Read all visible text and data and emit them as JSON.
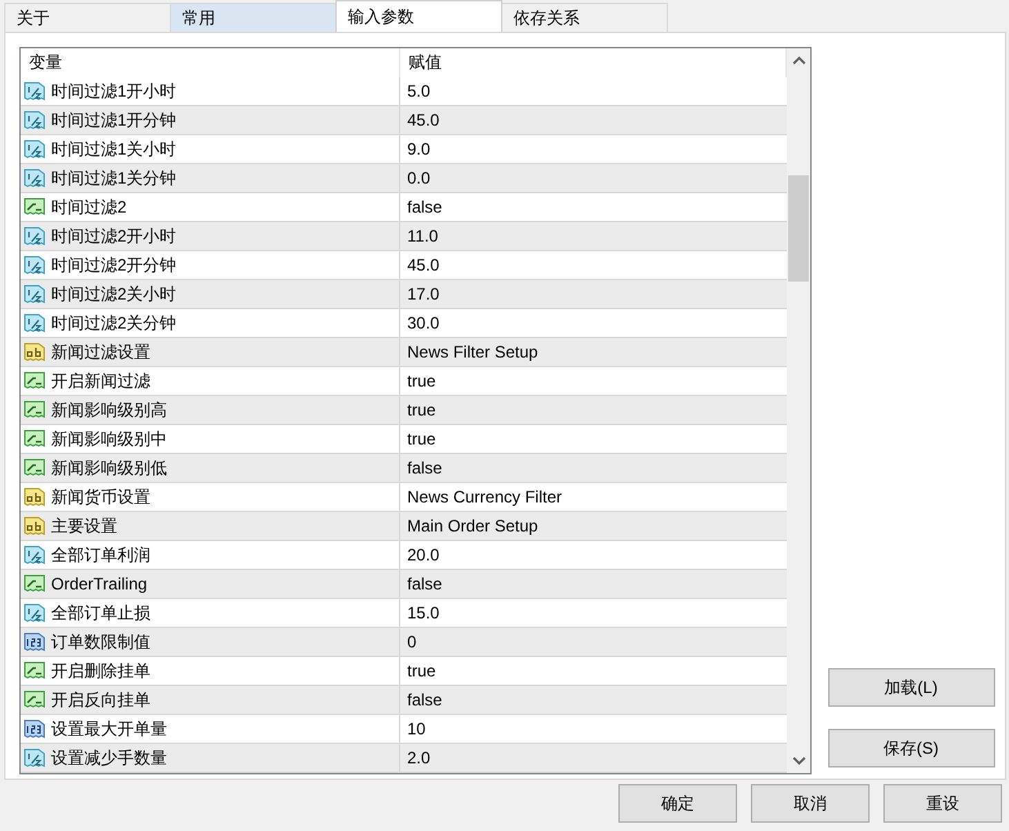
{
  "tabs": [
    {
      "label": "关于",
      "selected": false,
      "highlighted": false
    },
    {
      "label": "常用",
      "selected": false,
      "highlighted": true
    },
    {
      "label": "输入参数",
      "selected": true,
      "highlighted": false
    },
    {
      "label": "依存关系",
      "selected": false,
      "highlighted": false
    }
  ],
  "table": {
    "columns": [
      "变量",
      "赋值"
    ],
    "rows": [
      {
        "kind": "double",
        "name": "时间过滤1开小时",
        "value": "5.0"
      },
      {
        "kind": "double",
        "name": "时间过滤1开分钟",
        "value": "45.0"
      },
      {
        "kind": "double",
        "name": "时间过滤1关小时",
        "value": "9.0"
      },
      {
        "kind": "double",
        "name": "时间过滤1关分钟",
        "value": "0.0"
      },
      {
        "kind": "bool",
        "name": "时间过滤2",
        "value": "false"
      },
      {
        "kind": "double",
        "name": "时间过滤2开小时",
        "value": "11.0"
      },
      {
        "kind": "double",
        "name": "时间过滤2开分钟",
        "value": "45.0"
      },
      {
        "kind": "double",
        "name": "时间过滤2关小时",
        "value": "17.0"
      },
      {
        "kind": "double",
        "name": "时间过滤2关分钟",
        "value": "30.0"
      },
      {
        "kind": "string",
        "name": "新闻过滤设置",
        "value": "News Filter Setup"
      },
      {
        "kind": "bool",
        "name": "开启新闻过滤",
        "value": "true"
      },
      {
        "kind": "bool",
        "name": "新闻影响级别高",
        "value": "true"
      },
      {
        "kind": "bool",
        "name": "新闻影响级别中",
        "value": "true"
      },
      {
        "kind": "bool",
        "name": "新闻影响级别低",
        "value": "false"
      },
      {
        "kind": "string",
        "name": "新闻货币设置",
        "value": "News Currency Filter"
      },
      {
        "kind": "string",
        "name": "主要设置",
        "value": "Main Order Setup"
      },
      {
        "kind": "double",
        "name": "全部订单利润",
        "value": "20.0"
      },
      {
        "kind": "bool",
        "name": "OrderTrailing",
        "value": "false"
      },
      {
        "kind": "double",
        "name": "全部订单止损",
        "value": "15.0"
      },
      {
        "kind": "int",
        "name": "订单数限制值",
        "value": "0"
      },
      {
        "kind": "bool",
        "name": "开启删除挂单",
        "value": "true"
      },
      {
        "kind": "bool",
        "name": "开启反向挂单",
        "value": "false"
      },
      {
        "kind": "int",
        "name": "设置最大开单量",
        "value": "10"
      },
      {
        "kind": "double",
        "name": "设置减少手数量",
        "value": "2.0"
      }
    ]
  },
  "side_buttons": [
    "加载(L)",
    "保存(S)"
  ],
  "bottom_buttons": [
    "确定",
    "取消",
    "重设"
  ]
}
